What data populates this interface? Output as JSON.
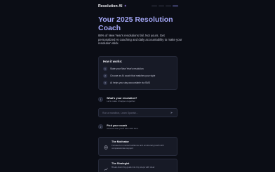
{
  "header": {
    "brand": "Resolution AI",
    "brand_icon": "sparkle-icon"
  },
  "hero": {
    "title": "Your 2025 Resolution Coach",
    "subtitle": "88% of New Year's resolutions fail. Not yours. Get personalized AI coaching and daily accountability to make your resolution stick."
  },
  "how_it_works": {
    "title": "How it works:",
    "steps": [
      {
        "num": "1",
        "text": "State your New Year's resolution"
      },
      {
        "num": "2",
        "text": "Choose an AI coach that matches your style"
      },
      {
        "num": "3",
        "text": "AI helps you stay accountable via SMS"
      }
    ]
  },
  "question_1": {
    "num": "1",
    "title": "What's your resolution?",
    "subtitle": "Let's make it happen together",
    "placeholder": "Run a marathon, Learn Spanish..."
  },
  "question_2": {
    "num": "2",
    "title": "Pick your coach",
    "subtitle": "Choose who you'll vibe with best",
    "coaches": [
      {
        "name": "The Motivator",
        "desc": "Focused on mental resilience and emotional growth with compassionate support",
        "icon": "target-icon"
      },
      {
        "name": "The Strategist",
        "desc": "Break down big goals into tiny steps with clear",
        "icon": "chart-icon"
      }
    ]
  },
  "colors": {
    "background": "#0b0d15",
    "accent": "#a3a6f5",
    "card": "#171a26"
  }
}
